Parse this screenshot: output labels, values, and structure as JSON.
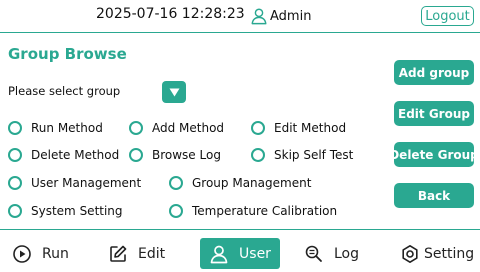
{
  "header": {
    "datetime": "2025-07-16 12:28:23",
    "username": "Admin",
    "logout_label": "Logout"
  },
  "page": {
    "title": "Group Browse",
    "select_label": "Please select group"
  },
  "permissions": [
    {
      "label": "Run Method"
    },
    {
      "label": "Add Method"
    },
    {
      "label": "Edit Method"
    },
    {
      "label": "Delete Method"
    },
    {
      "label": "Browse Log"
    },
    {
      "label": "Skip Self Test"
    },
    {
      "label": "User Management"
    },
    {
      "label": "Group Management"
    },
    {
      "label": "System Setting"
    },
    {
      "label": "Temperature Calibration"
    }
  ],
  "actions": {
    "add_group": "Add group",
    "edit_group": "Edit Group",
    "delete_group": "Delete Group",
    "back": "Back"
  },
  "nav": [
    {
      "label": "Run",
      "icon": "play-circle-icon"
    },
    {
      "label": "Edit",
      "icon": "edit-icon"
    },
    {
      "label": "User",
      "icon": "user-icon",
      "active": true
    },
    {
      "label": "Log",
      "icon": "search-list-icon"
    },
    {
      "label": "Setting",
      "icon": "gear-icon"
    }
  ],
  "colors": {
    "accent": "#2aa891",
    "text": "#111111",
    "background": "#ffffff"
  }
}
